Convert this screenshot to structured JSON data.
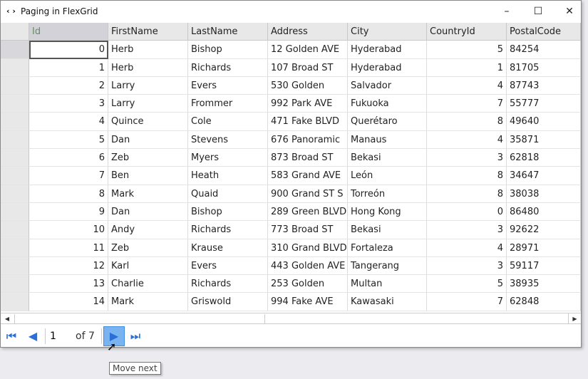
{
  "window": {
    "title": "Paging in FlexGrid",
    "icon": "code-icon",
    "minimize": "–",
    "maximize": "☐",
    "close": "✕"
  },
  "columns": [
    "Id",
    "FirstName",
    "LastName",
    "Address",
    "City",
    "CountryId",
    "PostalCode"
  ],
  "rows": [
    [
      "0",
      "Herb",
      "Bishop",
      "12 Golden AVE",
      "Hyderabad",
      "5",
      "84254"
    ],
    [
      "1",
      "Herb",
      "Richards",
      "107 Broad ST",
      "Hyderabad",
      "1",
      "81705"
    ],
    [
      "2",
      "Larry",
      "Evers",
      "530 Golden",
      "Salvador",
      "4",
      "87743"
    ],
    [
      "3",
      "Larry",
      "Frommer",
      "992 Park AVE",
      "Fukuoka",
      "7",
      "55777"
    ],
    [
      "4",
      "Quince",
      "Cole",
      "471 Fake BLVD",
      "Querétaro",
      "8",
      "49640"
    ],
    [
      "5",
      "Dan",
      "Stevens",
      "676 Panoramic",
      "Manaus",
      "4",
      "35871"
    ],
    [
      "6",
      "Zeb",
      "Myers",
      "873 Broad ST",
      "Bekasi",
      "3",
      "62818"
    ],
    [
      "7",
      "Ben",
      "Heath",
      "583 Grand AVE",
      "León",
      "8",
      "34647"
    ],
    [
      "8",
      "Mark",
      "Quaid",
      "900 Grand ST S",
      "Torreón",
      "8",
      "38038"
    ],
    [
      "9",
      "Dan",
      "Bishop",
      "289 Green BLVD",
      "Hong Kong",
      "0",
      "86480"
    ],
    [
      "10",
      "Andy",
      "Richards",
      "773 Broad ST",
      "Bekasi",
      "3",
      "92622"
    ],
    [
      "11",
      "Zeb",
      "Krause",
      "310 Grand BLVD",
      "Fortaleza",
      "4",
      "28971"
    ],
    [
      "12",
      "Karl",
      "Evers",
      "443 Golden AVE",
      "Tangerang",
      "3",
      "59117"
    ],
    [
      "13",
      "Charlie",
      "Richards",
      "253 Golden",
      "Multan",
      "5",
      "38935"
    ],
    [
      "14",
      "Mark",
      "Griswold",
      "994 Fake AVE",
      "Kawasaki",
      "7",
      "62848"
    ]
  ],
  "pager": {
    "current_page": "1",
    "of_label": "of 7"
  },
  "tooltip": "Move next"
}
